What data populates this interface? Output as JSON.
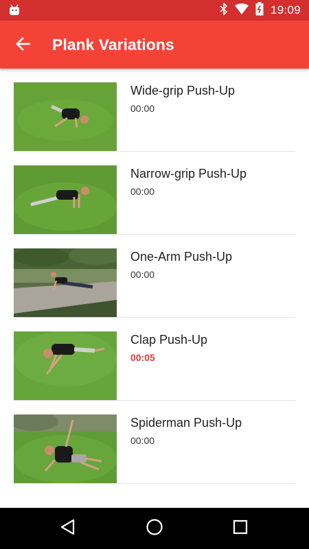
{
  "status_bar": {
    "time": "19:09",
    "icons": [
      "android-icon",
      "bluetooth-icon",
      "wifi-icon",
      "battery-charging-icon"
    ]
  },
  "app_bar": {
    "title": "Plank Variations",
    "back_icon": "arrow-left-icon"
  },
  "exercises": [
    {
      "name": "Wide-grip Push-Up",
      "time": "00:00",
      "active": false
    },
    {
      "name": "Narrow-grip Push-Up",
      "time": "00:00",
      "active": false
    },
    {
      "name": "One-Arm Push-Up",
      "time": "00:00",
      "active": false
    },
    {
      "name": "Clap Push-Up",
      "time": "00:05",
      "active": true
    },
    {
      "name": "Spiderman Push-Up",
      "time": "00:00",
      "active": false
    }
  ],
  "colors": {
    "status_bar": "#d32f2f",
    "app_bar": "#f44336",
    "active_time": "#e53935"
  },
  "nav_bar": {
    "buttons": [
      "back-triangle-icon",
      "home-circle-icon",
      "recents-square-icon"
    ]
  }
}
